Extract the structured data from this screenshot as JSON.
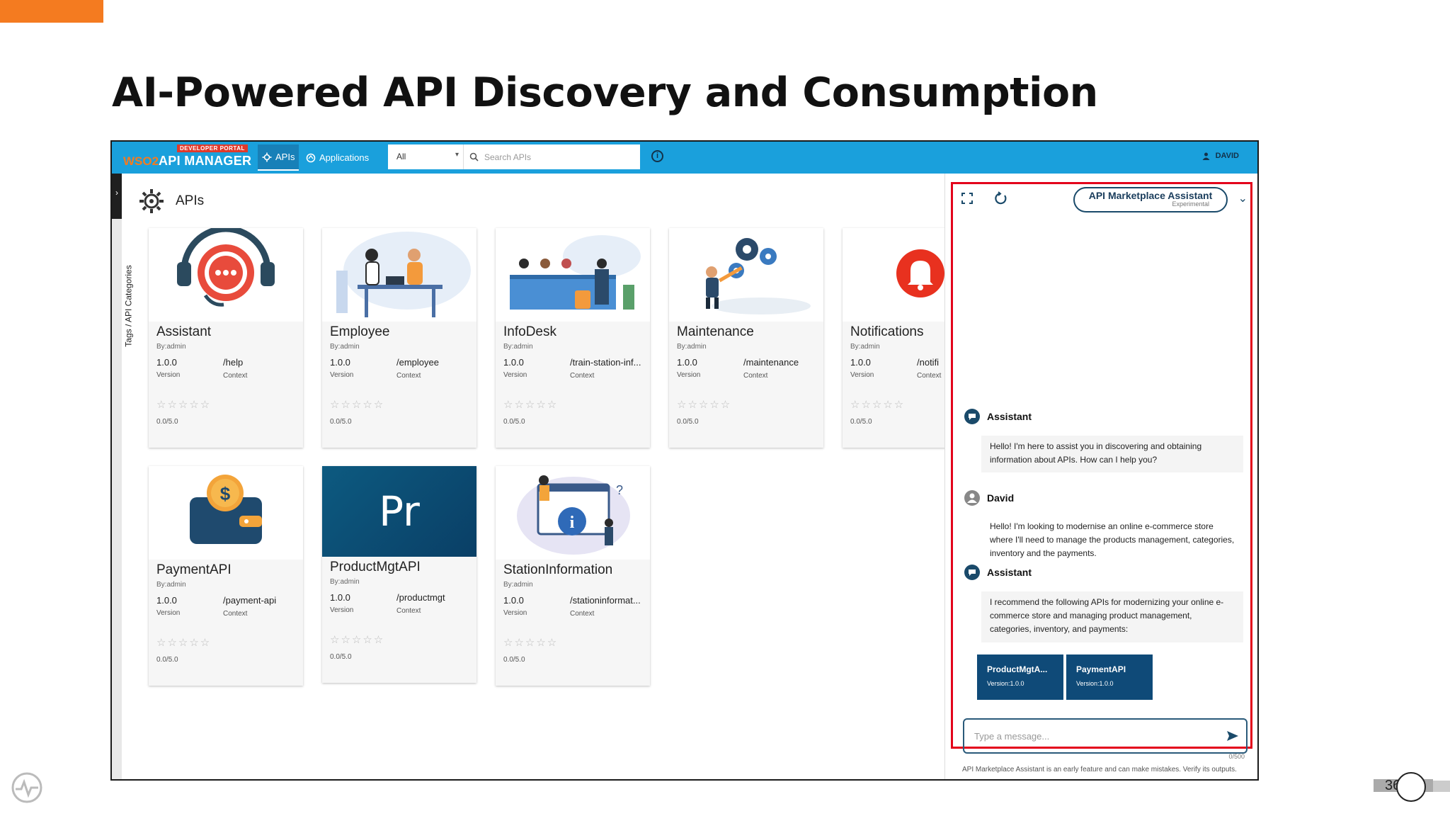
{
  "slide": {
    "title": "AI-Powered API Discovery and Consumption",
    "page_number": "36"
  },
  "topbar": {
    "badge": "DEVELOPER PORTAL",
    "brand_prefix": "WSO2",
    "brand": "API MANAGER",
    "nav_apis": "APIs",
    "nav_applications": "Applications",
    "filter_value": "All",
    "search_placeholder": "Search APIs",
    "user": "DAVID"
  },
  "sidebar": {
    "vertical_label": "Tags / API Categories"
  },
  "main": {
    "heading": "APIs",
    "by_label_version": "Version",
    "context_label": "Context",
    "cards": [
      {
        "name": "Assistant",
        "by": "By:admin",
        "version": "1.0.0",
        "context": "/help",
        "rating": "0.0/5.0"
      },
      {
        "name": "Employee",
        "by": "By:admin",
        "version": "1.0.0",
        "context": "/employee",
        "rating": "0.0/5.0"
      },
      {
        "name": "InfoDesk",
        "by": "By:admin",
        "version": "1.0.0",
        "context": "/train-station-inf...",
        "rating": "0.0/5.0"
      },
      {
        "name": "Maintenance",
        "by": "By:admin",
        "version": "1.0.0",
        "context": "/maintenance",
        "rating": "0.0/5.0"
      },
      {
        "name": "Notifications",
        "by": "By:admin",
        "version": "1.0.0",
        "context": "/notifi",
        "rating": "0.0/5.0"
      },
      {
        "name": "PaymentAPI",
        "by": "By:admin",
        "version": "1.0.0",
        "context": "/payment-api",
        "rating": "0.0/5.0"
      },
      {
        "name": "ProductMgtAPI",
        "by": "By:admin",
        "version": "1.0.0",
        "context": "/productmgt",
        "rating": "0.0/5.0",
        "thumb_text": "Pr"
      },
      {
        "name": "StationInformation",
        "by": "By:admin",
        "version": "1.0.0",
        "context": "/stationinformat...",
        "rating": "0.0/5.0"
      }
    ]
  },
  "chat": {
    "title": "API Marketplace Assistant",
    "subtitle": "Experimental",
    "messages": [
      {
        "sender": "Assistant",
        "text": "Hello! I'm here to assist you in discovering and obtaining information about APIs. How can I help you?"
      },
      {
        "sender": "David",
        "text": "Hello! I'm looking to modernise an online e-commerce store where I'll need to manage the products management, categories, inventory and the payments."
      },
      {
        "sender": "Assistant",
        "text": "I recommend the following APIs for modernizing your online e-commerce store and managing product management, categories, inventory, and payments:"
      }
    ],
    "recommended": [
      {
        "name": "ProductMgtA...",
        "version": "Version:1.0.0"
      },
      {
        "name": "PaymentAPI",
        "version": "Version:1.0.0"
      }
    ],
    "input_placeholder": "Type a message...",
    "char_count": "0/500",
    "disclaimer": "API Marketplace Assistant is an early feature and can make mistakes. Verify its outputs."
  },
  "colors": {
    "accent_orange": "#f47b20",
    "topbar_blue": "#1aa0dc",
    "highlight_red": "#e3001b",
    "chip_navy": "#0f4a78"
  }
}
